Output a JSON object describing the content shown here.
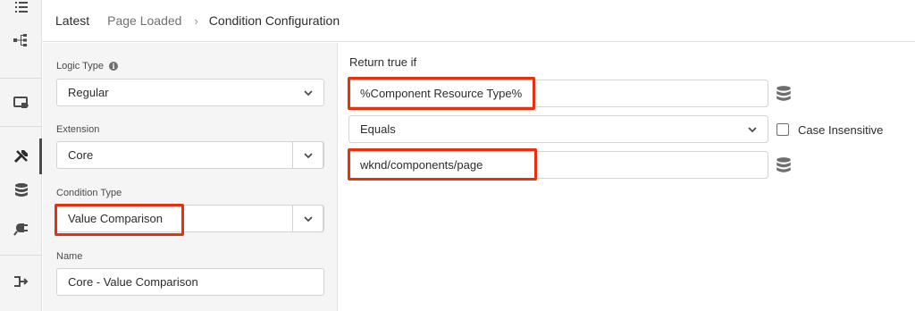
{
  "breadcrumb": {
    "items": [
      "Latest",
      "Page Loaded",
      "Condition Configuration"
    ],
    "separator": "›"
  },
  "rail": {
    "icons": [
      "list-icon",
      "tree-icon",
      "tag-screen-icon",
      "tools-icon",
      "database-icon",
      "plug-icon",
      "exit-icon"
    ]
  },
  "left_panel": {
    "logic_type": {
      "label": "Logic Type",
      "value": "Regular"
    },
    "extension": {
      "label": "Extension",
      "value": "Core"
    },
    "condition_type": {
      "label": "Condition Type",
      "value": "Value Comparison"
    },
    "name": {
      "label": "Name",
      "value": "Core - Value Comparison"
    }
  },
  "right_panel": {
    "return_label": "Return true if",
    "left_operand": "%Component Resource Type%",
    "operator": "Equals",
    "right_operand": "wknd/components/page",
    "case_insensitive_label": "Case Insensitive",
    "case_insensitive_checked": false
  },
  "colors": {
    "highlight": "#e8300e",
    "rail_bg": "#f4f4f4",
    "panel_bg": "#f5f5f5"
  }
}
